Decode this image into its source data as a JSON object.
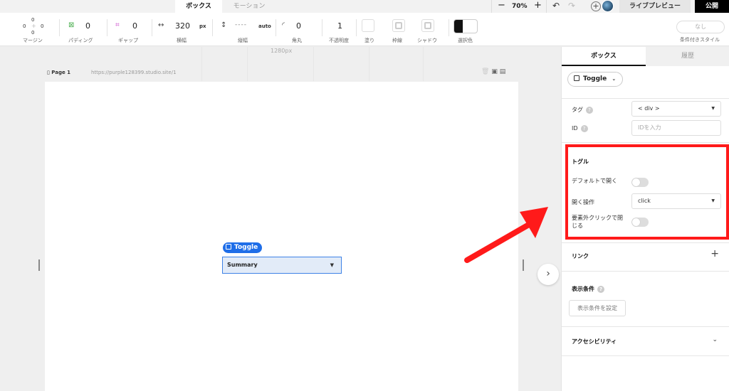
{
  "topbar": {
    "tabs": [
      "ボックス",
      "モーション"
    ],
    "zoom_minus": "−",
    "zoom": "70%",
    "zoom_plus": "+",
    "preview_label": "ライブプレビュー",
    "publish_label": "公開"
  },
  "toolbar": {
    "margin": {
      "label": "マージン",
      "top": "0",
      "left": "0",
      "right": "0",
      "bottom": "0"
    },
    "padding": {
      "label": "パディング",
      "value": "0"
    },
    "gap": {
      "label": "ギャップ",
      "value": "0"
    },
    "width": {
      "label": "横幅",
      "value": "320",
      "unit": "px"
    },
    "height": {
      "label": "縦幅",
      "value": "----",
      "unit": "auto"
    },
    "radius": {
      "label": "角丸",
      "value": "0"
    },
    "opacity": {
      "label": "不透明度",
      "value": "1"
    },
    "fill_label": "塗り",
    "border_label": "枠線",
    "shadow_label": "シャドウ",
    "selection_color_label": "選択色",
    "style": {
      "value": "なし",
      "label": "条件付きスタイル"
    }
  },
  "canvas": {
    "ruler_label": "1280px",
    "page_label": "Page 1",
    "page_url": "https://purple128399.studio.site/1",
    "toggle_chip_label": "Toggle",
    "summary_text": "Summary"
  },
  "panel": {
    "tabs": [
      "ボックス",
      "履歴"
    ],
    "component_label": "Toggle",
    "tag_label": "タグ",
    "tag_value": "< div >",
    "id_label": "ID",
    "id_placeholder": "IDを入力",
    "toggle_section": {
      "title": "トグル",
      "default_open_label": "デフォルトで開く",
      "default_open": false,
      "open_action_label": "開く操作",
      "open_action_value": "click",
      "close_outside_label_1": "要素外クリックで閉",
      "close_outside_label_2": "じる",
      "close_outside": false
    },
    "link_title": "リンク",
    "display_condition_title": "表示条件",
    "display_condition_button": "表示条件を設定",
    "accessibility_title": "アクセシビリティ"
  },
  "colors": {
    "accent": "#1f6ee8",
    "highlight": "#ff1a1a",
    "publish_bg": "#000000"
  }
}
